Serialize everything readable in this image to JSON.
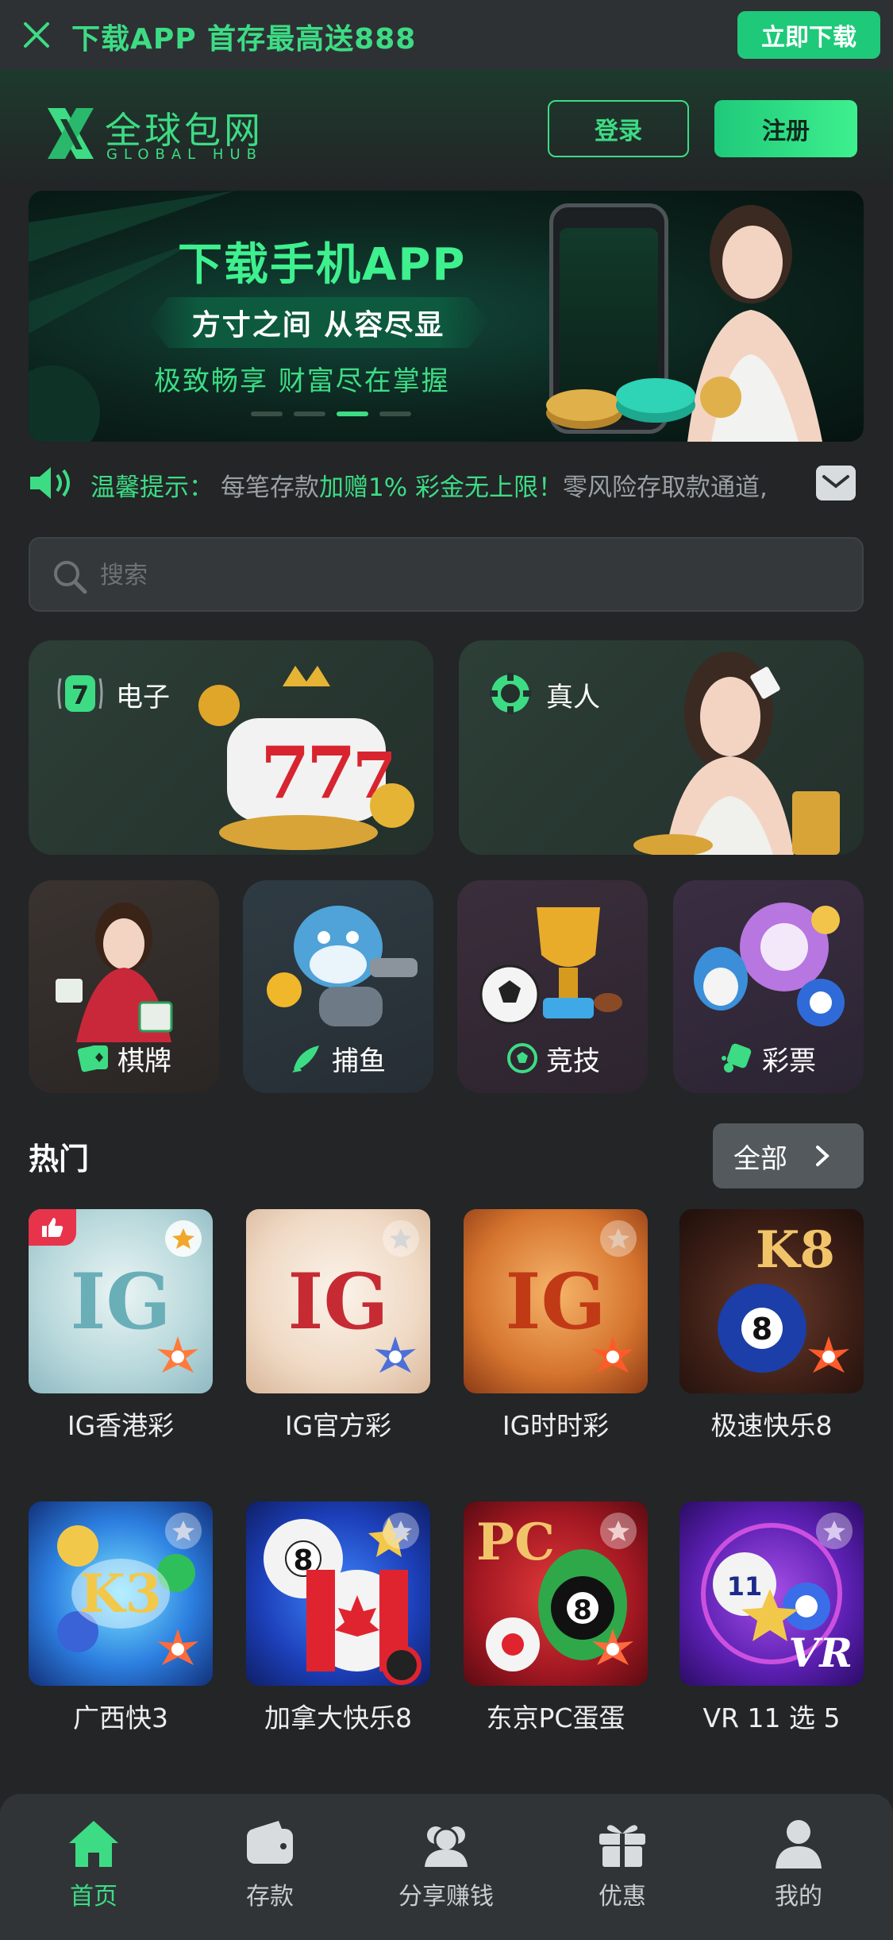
{
  "download_bar": {
    "text": "下载APP 首存最高送888",
    "button": "立即下载"
  },
  "header": {
    "logo_cn": "全球包网",
    "logo_en": "GLOBAL HUB",
    "login": "登录",
    "register": "注册"
  },
  "banner": {
    "headline": "下载手机APP",
    "subtitle": "方寸之间 从容尽显",
    "tagline": "极致畅享 财富尽在掌握"
  },
  "notice": {
    "label": "温馨提示：",
    "text_a": "每笔存款",
    "text_highlight": "加赠1% 彩金无上限！",
    "text_b": "零风险存取款通道,"
  },
  "search": {
    "placeholder": "搜索"
  },
  "categories_big": [
    {
      "label": "电子"
    },
    {
      "label": "真人"
    }
  ],
  "categories_small": [
    {
      "label": "棋牌"
    },
    {
      "label": "捕鱼"
    },
    {
      "label": "竞技"
    },
    {
      "label": "彩票"
    }
  ],
  "hot": {
    "title": "热门",
    "all_label": "全部",
    "games": [
      {
        "name": "IG香港彩",
        "art": "IG"
      },
      {
        "name": "IG官方彩",
        "art": "IG"
      },
      {
        "name": "IG时时彩",
        "art": "IG"
      },
      {
        "name": "极速快乐8",
        "art": "K8"
      },
      {
        "name": "广西快3",
        "art": "K3"
      },
      {
        "name": "加拿大快乐8",
        "art": "8"
      },
      {
        "name": "东京PC蛋蛋",
        "art": "PC"
      },
      {
        "name": "VR 11 选 5",
        "art": "VR"
      }
    ]
  },
  "tabbar": [
    {
      "label": "首页"
    },
    {
      "label": "存款"
    },
    {
      "label": "分享赚钱"
    },
    {
      "label": "优惠"
    },
    {
      "label": "我的"
    }
  ],
  "colors": {
    "accent": "#3ddc84",
    "background": "#232527",
    "tabbar": "#303437"
  }
}
